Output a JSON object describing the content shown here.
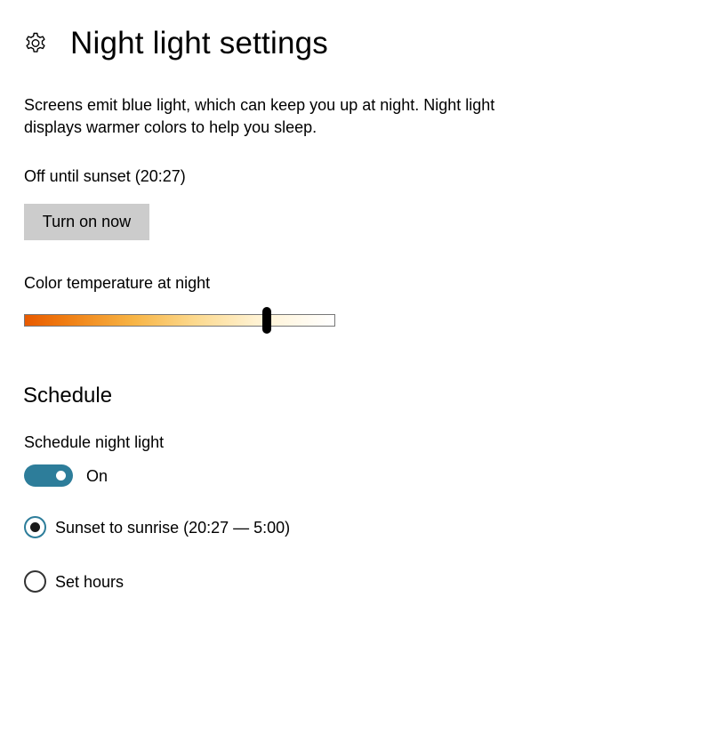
{
  "header": {
    "title": "Night light settings",
    "icon": "gear-icon"
  },
  "description": "Screens emit blue light, which can keep you up at night. Night light displays warmer colors to help you sleep.",
  "status": "Off until sunset (20:27)",
  "turn_on_button": "Turn on now",
  "color_temperature": {
    "label": "Color temperature at night",
    "value_fraction": 0.78
  },
  "schedule": {
    "title": "Schedule",
    "toggle_label": "Schedule night light",
    "toggle_state_text": "On",
    "toggle_on": true,
    "options": [
      {
        "label": "Sunset to sunrise (20:27 — 5:00)",
        "selected": true
      },
      {
        "label": "Set hours",
        "selected": false
      }
    ]
  },
  "colors": {
    "accent": "#2d7d9a",
    "button_bg": "#cccccc",
    "gradient_warm": "#e85a00",
    "gradient_cool": "#ffffff"
  }
}
